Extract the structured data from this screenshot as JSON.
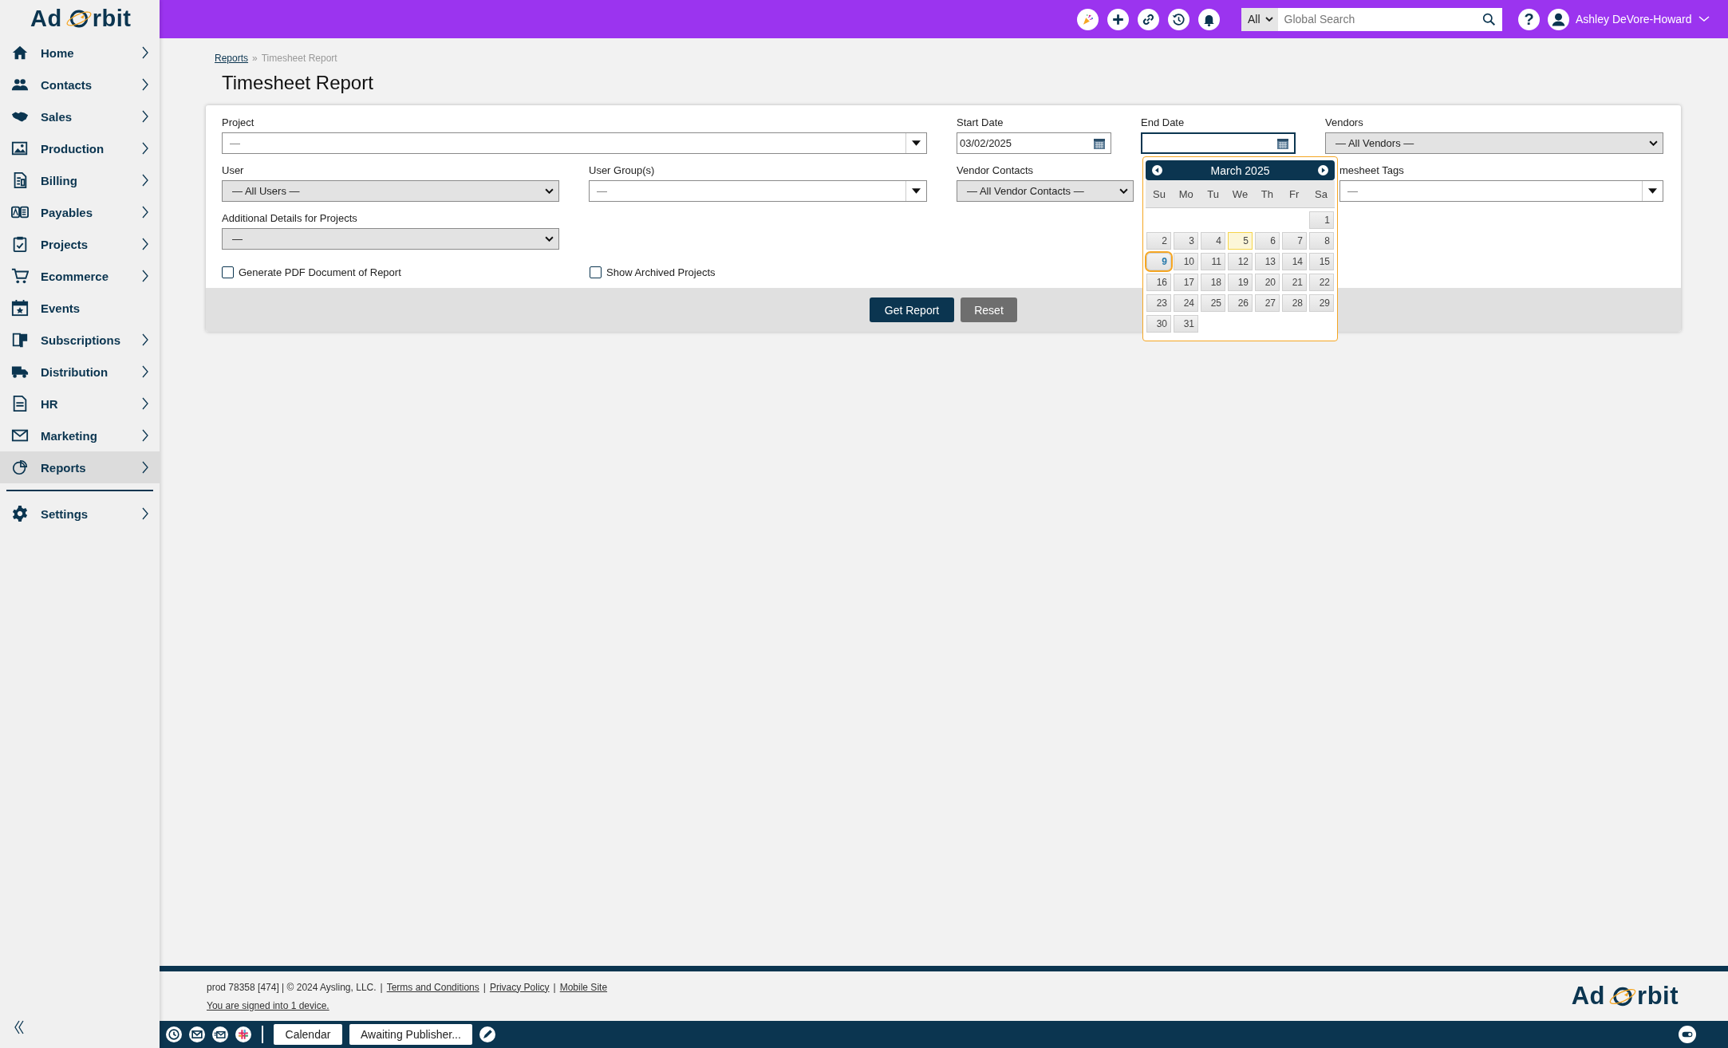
{
  "logo": {
    "left": "Ad",
    "right": "rbit"
  },
  "topbar": {
    "search_scope": "All",
    "search": {
      "placeholder": "Global Search"
    },
    "help_label": "?",
    "user_name": "Ashley DeVore-Howard"
  },
  "sidebar": {
    "items": [
      {
        "label": "Home",
        "has_submenu": true,
        "selected": false
      },
      {
        "label": "Contacts",
        "has_submenu": true,
        "selected": false
      },
      {
        "label": "Sales",
        "has_submenu": true,
        "selected": false
      },
      {
        "label": "Production",
        "has_submenu": true,
        "selected": false
      },
      {
        "label": "Billing",
        "has_submenu": true,
        "selected": false
      },
      {
        "label": "Payables",
        "has_submenu": true,
        "selected": false
      },
      {
        "label": "Projects",
        "has_submenu": true,
        "selected": false
      },
      {
        "label": "Ecommerce",
        "has_submenu": true,
        "selected": false
      },
      {
        "label": "Events",
        "has_submenu": false,
        "selected": false
      },
      {
        "label": "Subscriptions",
        "has_submenu": true,
        "selected": false
      },
      {
        "label": "Distribution",
        "has_submenu": true,
        "selected": false
      },
      {
        "label": "HR",
        "has_submenu": true,
        "selected": false
      },
      {
        "label": "Marketing",
        "has_submenu": true,
        "selected": false
      },
      {
        "label": "Reports",
        "has_submenu": true,
        "selected": true
      }
    ],
    "bottom_items": [
      {
        "label": "Settings",
        "has_submenu": true,
        "selected": false
      }
    ]
  },
  "breadcrumb": {
    "separator": "»",
    "items": [
      {
        "label": "Reports",
        "link": true
      },
      {
        "label": "Timesheet Report",
        "link": false
      }
    ]
  },
  "title": "Timesheet Report",
  "form": {
    "fields": [
      {
        "label": "Project",
        "kind": "combo",
        "placeholder": "—",
        "focused": false
      },
      {
        "label": "Start Date",
        "kind": "date",
        "value": "03/02/2025",
        "focused": false
      },
      {
        "label": "End Date",
        "kind": "date",
        "focused": true
      },
      {
        "label": "Vendors",
        "kind": "select",
        "value": "— All Vendors —",
        "focused": false
      },
      {
        "label": "User",
        "kind": "select",
        "value": "— All Users —",
        "focused": false
      },
      {
        "label": "User Group(s)",
        "kind": "combo",
        "placeholder": "—",
        "focused": false
      },
      {
        "label": "Vendor Contacts",
        "kind": "select",
        "value": "— All Vendor Contacts —",
        "focused": false
      },
      {
        "label": "mesheet Tags",
        "kind": "combo",
        "placeholder": "—",
        "focused": false
      },
      {
        "label": "Additional Details for Projects",
        "kind": "select",
        "value": "—",
        "focused": false
      }
    ],
    "checkboxes": [
      {
        "label": "Generate PDF Document of Report",
        "checked": false
      },
      {
        "label": "Show Archived Projects",
        "checked": false
      }
    ],
    "buttons": [
      {
        "label": "Get Report",
        "kind": "primary"
      },
      {
        "label": "Reset",
        "kind": "secondary"
      }
    ]
  },
  "datepicker": {
    "month": "March 2025",
    "weekdays": [
      "Su",
      "Mo",
      "Tu",
      "We",
      "Th",
      "Fr",
      "Sa"
    ],
    "weeks": [
      [
        {
          "label": "1",
          "today": false,
          "highlighted": false
        }
      ],
      [
        {
          "label": "2",
          "today": false,
          "highlighted": false
        },
        {
          "label": "3",
          "today": false,
          "highlighted": false
        },
        {
          "label": "4",
          "today": false,
          "highlighted": false
        },
        {
          "label": "5",
          "today": true,
          "highlighted": false
        },
        {
          "label": "6",
          "today": false,
          "highlighted": false
        },
        {
          "label": "7",
          "today": false,
          "highlighted": false
        },
        {
          "label": "8",
          "today": false,
          "highlighted": false
        }
      ],
      [
        {
          "label": "9",
          "today": false,
          "highlighted": true
        },
        {
          "label": "10",
          "today": false,
          "highlighted": false
        },
        {
          "label": "11",
          "today": false,
          "highlighted": false
        },
        {
          "label": "12",
          "today": false,
          "highlighted": false
        },
        {
          "label": "13",
          "today": false,
          "highlighted": false
        },
        {
          "label": "14",
          "today": false,
          "highlighted": false
        },
        {
          "label": "15",
          "today": false,
          "highlighted": false
        }
      ],
      [
        {
          "label": "16",
          "today": false,
          "highlighted": false
        },
        {
          "label": "17",
          "today": false,
          "highlighted": false
        },
        {
          "label": "18",
          "today": false,
          "highlighted": false
        },
        {
          "label": "19",
          "today": false,
          "highlighted": false
        },
        {
          "label": "20",
          "today": false,
          "highlighted": false
        },
        {
          "label": "21",
          "today": false,
          "highlighted": false
        },
        {
          "label": "22",
          "today": false,
          "highlighted": false
        }
      ],
      [
        {
          "label": "23",
          "today": false,
          "highlighted": false
        },
        {
          "label": "24",
          "today": false,
          "highlighted": false
        },
        {
          "label": "25",
          "today": false,
          "highlighted": false
        },
        {
          "label": "26",
          "today": false,
          "highlighted": false
        },
        {
          "label": "27",
          "today": false,
          "highlighted": false
        },
        {
          "label": "28",
          "today": false,
          "highlighted": false
        },
        {
          "label": "29",
          "today": false,
          "highlighted": false
        }
      ],
      [
        {
          "label": "30",
          "today": false,
          "highlighted": false
        },
        {
          "label": "31",
          "today": false,
          "highlighted": false
        }
      ]
    ]
  },
  "footer": {
    "separator": "|",
    "parts": [
      {
        "text": "prod 78358 [474] | © 2024 Aysling, LLC.",
        "link": false
      },
      {
        "text": "Terms and Conditions",
        "link": true
      },
      {
        "text": "Privacy Policy",
        "link": true
      },
      {
        "text": "Mobile Site",
        "link": true
      }
    ],
    "signed_in": "You are signed into 1 device.",
    "logo": {
      "left": "Ad",
      "right": "rbit"
    }
  },
  "taskbar": {
    "tabs": [
      "Calendar",
      "Awaiting Publisher..."
    ]
  }
}
